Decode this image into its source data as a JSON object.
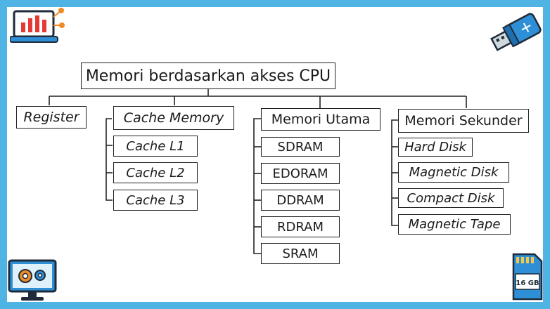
{
  "diagram": {
    "root": "Memori berdasarkan akses CPU",
    "categories": [
      {
        "label": "Register",
        "items": []
      },
      {
        "label": "Cache Memory",
        "items": [
          "Cache L1",
          "Cache L2",
          "Cache L3"
        ]
      },
      {
        "label": "Memori Utama",
        "items": [
          "SDRAM",
          "EDORAM",
          "DDRAM",
          "RDRAM",
          "SRAM"
        ]
      },
      {
        "label": "Memori Sekunder",
        "items": [
          "Hard Disk",
          "Magnetic Disk",
          "Compact Disk",
          "Magnetic Tape"
        ]
      }
    ]
  },
  "decor": {
    "sd_card_label": "16 GB",
    "icons": [
      "laptop-chart-icon",
      "usb-drive-icon",
      "monitor-gears-icon",
      "sd-card-icon"
    ]
  },
  "colors": {
    "border": "#4fb3e4",
    "line": "#222222",
    "icon_blue": "#2f8fd6",
    "icon_orange": "#f08a24",
    "icon_red": "#e53935"
  }
}
